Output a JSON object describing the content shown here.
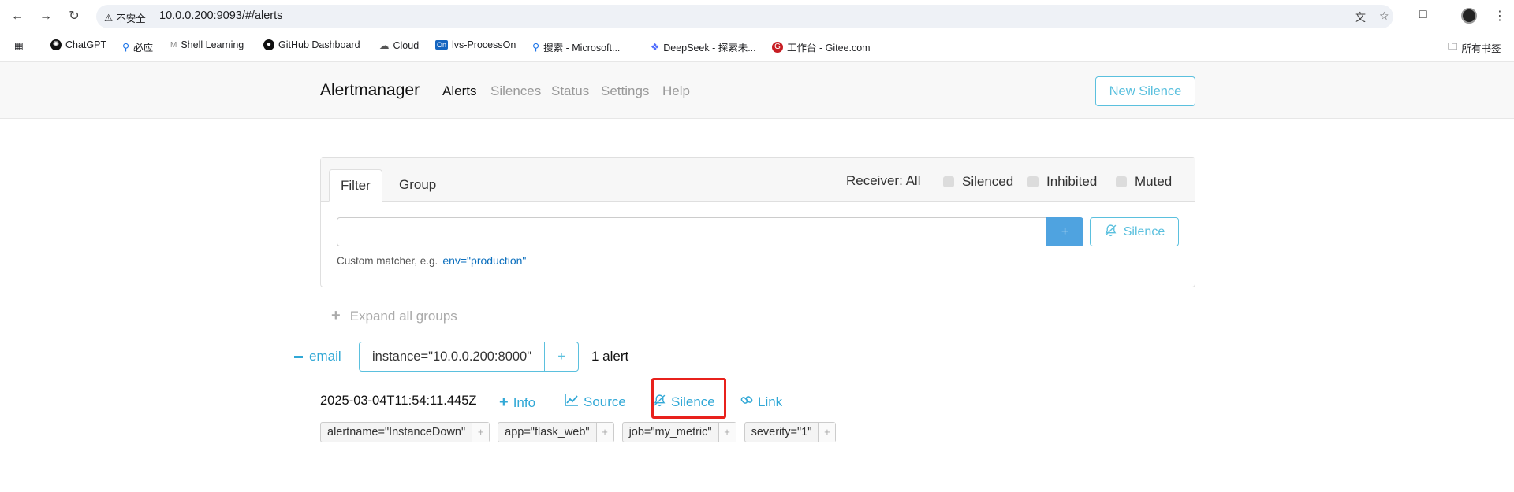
{
  "browser": {
    "insecure_label": "不安全",
    "url": "10.0.0.200:9093/#/alerts",
    "bookmarks": [
      {
        "label": "ChatGPT",
        "icon": "chatgpt-icon",
        "color": "#111111"
      },
      {
        "label": "必应",
        "icon": "search-icon",
        "color": "#1a73e8"
      },
      {
        "label": "Shell Learning",
        "icon": "shell-icon",
        "color": "#888888"
      },
      {
        "label": "GitHub Dashboard",
        "icon": "github-icon",
        "color": "#111111"
      },
      {
        "label": "Cloud",
        "icon": "cloud-icon",
        "color": "#555555"
      },
      {
        "label": "lvs-ProcessOn",
        "icon": "processon-icon",
        "color": "#1565c0"
      },
      {
        "label": "搜索 - Microsoft...",
        "icon": "search-icon",
        "color": "#1a73e8"
      },
      {
        "label": "DeepSeek - 探索未...",
        "icon": "deepseek-icon",
        "color": "#4d6bfe"
      },
      {
        "label": "工作台 - Gitee.com",
        "icon": "gitee-icon",
        "color": "#c71d23"
      }
    ],
    "all_bookmarks_label": "所有书签"
  },
  "navbar": {
    "brand": "Alertmanager",
    "links": [
      "Alerts",
      "Silences",
      "Status",
      "Settings",
      "Help"
    ],
    "active": "Alerts",
    "new_silence_label": "New Silence"
  },
  "filter": {
    "tabs": [
      "Filter",
      "Group"
    ],
    "active_tab": "Filter",
    "receiver_label": "Receiver: All",
    "checkboxes": [
      "Silenced",
      "Inhibited",
      "Muted"
    ],
    "input_value": "",
    "plus_label": "+",
    "silence_label": "Silence",
    "hint_text": "Custom matcher, e.g.",
    "hint_example": "env=\"production\""
  },
  "groups": {
    "expand_label": "Expand all groups",
    "group_receiver": "email",
    "group_matcher": "instance=\"10.0.0.200:8000\"",
    "group_matcher_add": "+",
    "alert_count": "1 alert",
    "alert": {
      "timestamp": "2025-03-04T11:54:11.445Z",
      "actions": [
        "Info",
        "Source",
        "Silence",
        "Link"
      ],
      "labels": [
        "alertname=\"InstanceDown\"",
        "app=\"flask_web\"",
        "job=\"my_metric\"",
        "severity=\"1\""
      ],
      "label_add": "+"
    }
  },
  "colors": {
    "accent": "#5bc0de",
    "link": "#31a8d6",
    "primary": "#4fa3e0",
    "highlight": "#e8211c"
  }
}
